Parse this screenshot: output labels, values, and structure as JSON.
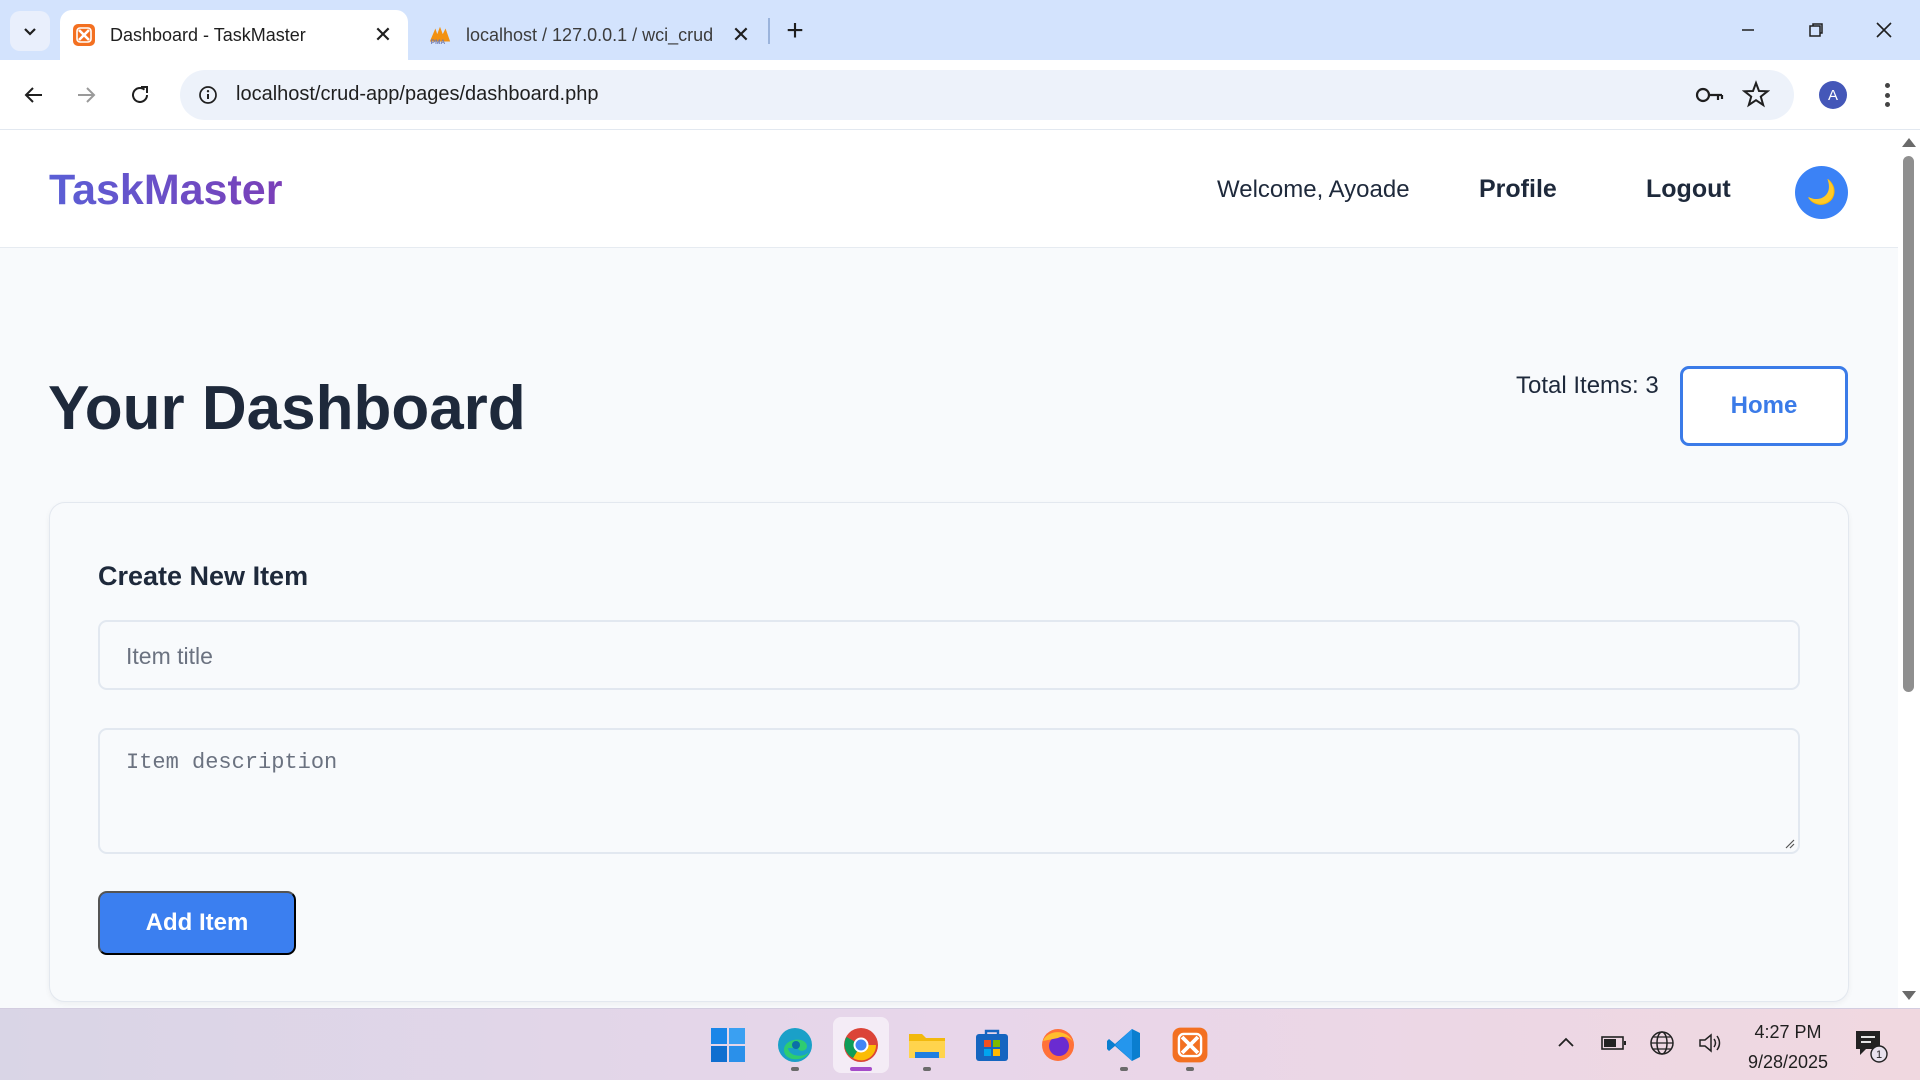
{
  "browser": {
    "tabs": [
      {
        "title": "Dashboard - TaskMaster",
        "active": true
      },
      {
        "title": "localhost / 127.0.0.1 / wci_crud",
        "active": false
      }
    ],
    "url": "localhost/crud-app/pages/dashboard.php",
    "profile_initial": "A"
  },
  "site": {
    "brand": "TaskMaster",
    "welcome": "Welcome, Ayoade",
    "nav": {
      "profile": "Profile",
      "logout": "Logout"
    },
    "theme_toggle_icon": "🌙"
  },
  "dashboard": {
    "title": "Your Dashboard",
    "total_items": "Total Items: 3",
    "home_button": "Home"
  },
  "create_form": {
    "heading": "Create New Item",
    "title_placeholder": "Item title",
    "description_placeholder": "Item description",
    "submit_label": "Add Item"
  },
  "taskbar": {
    "apps": [
      "start",
      "edge",
      "chrome",
      "file-explorer",
      "microsoft-store",
      "firefox",
      "vscode",
      "xampp"
    ],
    "time": "4:27 PM",
    "date": "9/28/2025",
    "notification_count": "1"
  },
  "colors": {
    "accent": "#3b7ff0",
    "brand_gradient_start": "#5a5fd6",
    "brand_gradient_end": "#7b3fb8",
    "tabstrip": "#d3e3fd"
  }
}
